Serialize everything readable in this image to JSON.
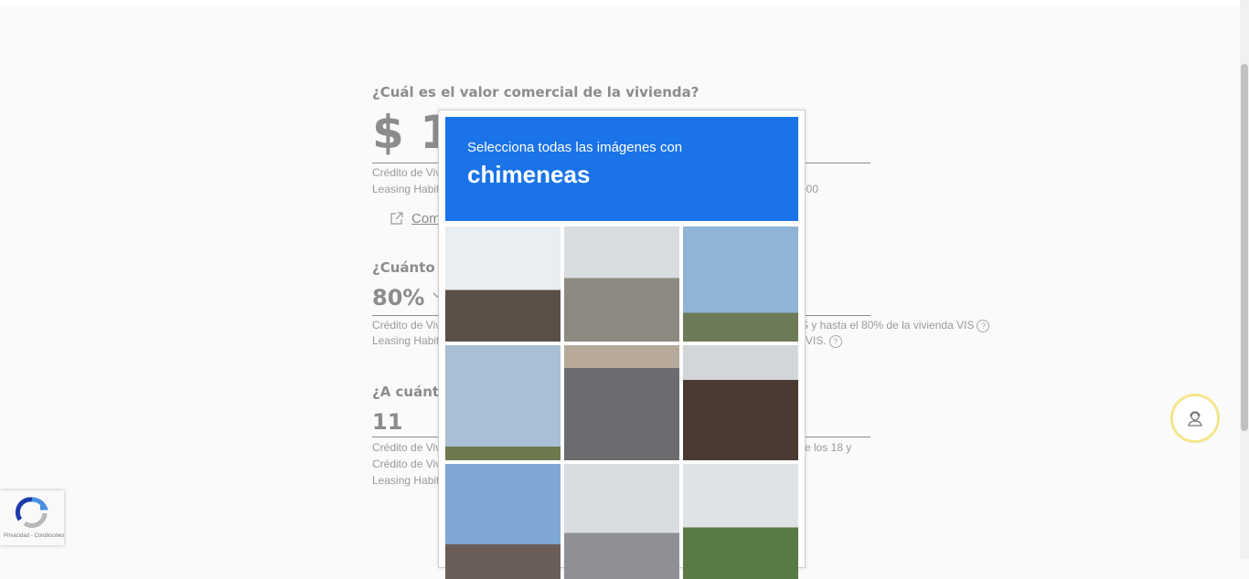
{
  "form": {
    "q1": "¿Cuál es el valor comercial de la vivienda?",
    "q1_value": "$ 1",
    "q1_note1": "Crédito de Viv",
    "q1_note2": "Leasing Habit",
    "q1_note2_tail": "000",
    "link_label": "Com",
    "q2": "¿Cuánto c",
    "q2_value": "80%",
    "q2_note1": "Crédito de Viv",
    "q2_note1_tail": "S y hasta el 80% de la vivienda VIS",
    "q2_note2": "Leasing Habit",
    "q2_note2_tail": "VIS.",
    "q3": "¿A cuánto",
    "q3_value": "11",
    "q3_note1": "Crédito de Viv",
    "q3_note1_tail": "re los 18 y",
    "q3_note2": "Crédito de Viv",
    "q3_note3": "Leasing Habit",
    "help_glyph": "?"
  },
  "captcha": {
    "instruction": "Selecciona todas las imágenes con",
    "target": "chimeneas",
    "tiles": [
      {
        "name": "tile-house-roof-chimney",
        "sky": "#e9eef2",
        "ground": "#5a5048"
      },
      {
        "name": "tile-railroad-crossing-suv",
        "sky": "#d9dde0",
        "ground": "#8c8a80"
      },
      {
        "name": "tile-street-sign-pole",
        "sky": "#8fb4d8",
        "ground": "#6c7a57"
      },
      {
        "name": "tile-open-sky-field",
        "sky": "#a9bfd3",
        "ground": "#6e7a4d"
      },
      {
        "name": "tile-parked-motorcycles",
        "sky": "#b6a999",
        "ground": "#6b6c70"
      },
      {
        "name": "tile-brick-house",
        "sky": "#d3d6d8",
        "ground": "#4a3a32"
      },
      {
        "name": "tile-house-clouds",
        "sky": "#7ea7d6",
        "ground": "#6b5e58"
      },
      {
        "name": "tile-traffic-lights",
        "sky": "#d9dde2",
        "ground": "#8e9096"
      },
      {
        "name": "tile-road-trees",
        "sky": "#dfe3e6",
        "ground": "#5a7a45"
      }
    ]
  },
  "recaptcha_badge": {
    "text": "Privacidad - Condiciones"
  },
  "colors": {
    "captcha_header": "#1a73e8",
    "support_ring": "#f4e58c"
  },
  "icons": {
    "support": "headset-user-icon",
    "external": "external-link-icon",
    "chevron": "chevron-down-icon"
  }
}
